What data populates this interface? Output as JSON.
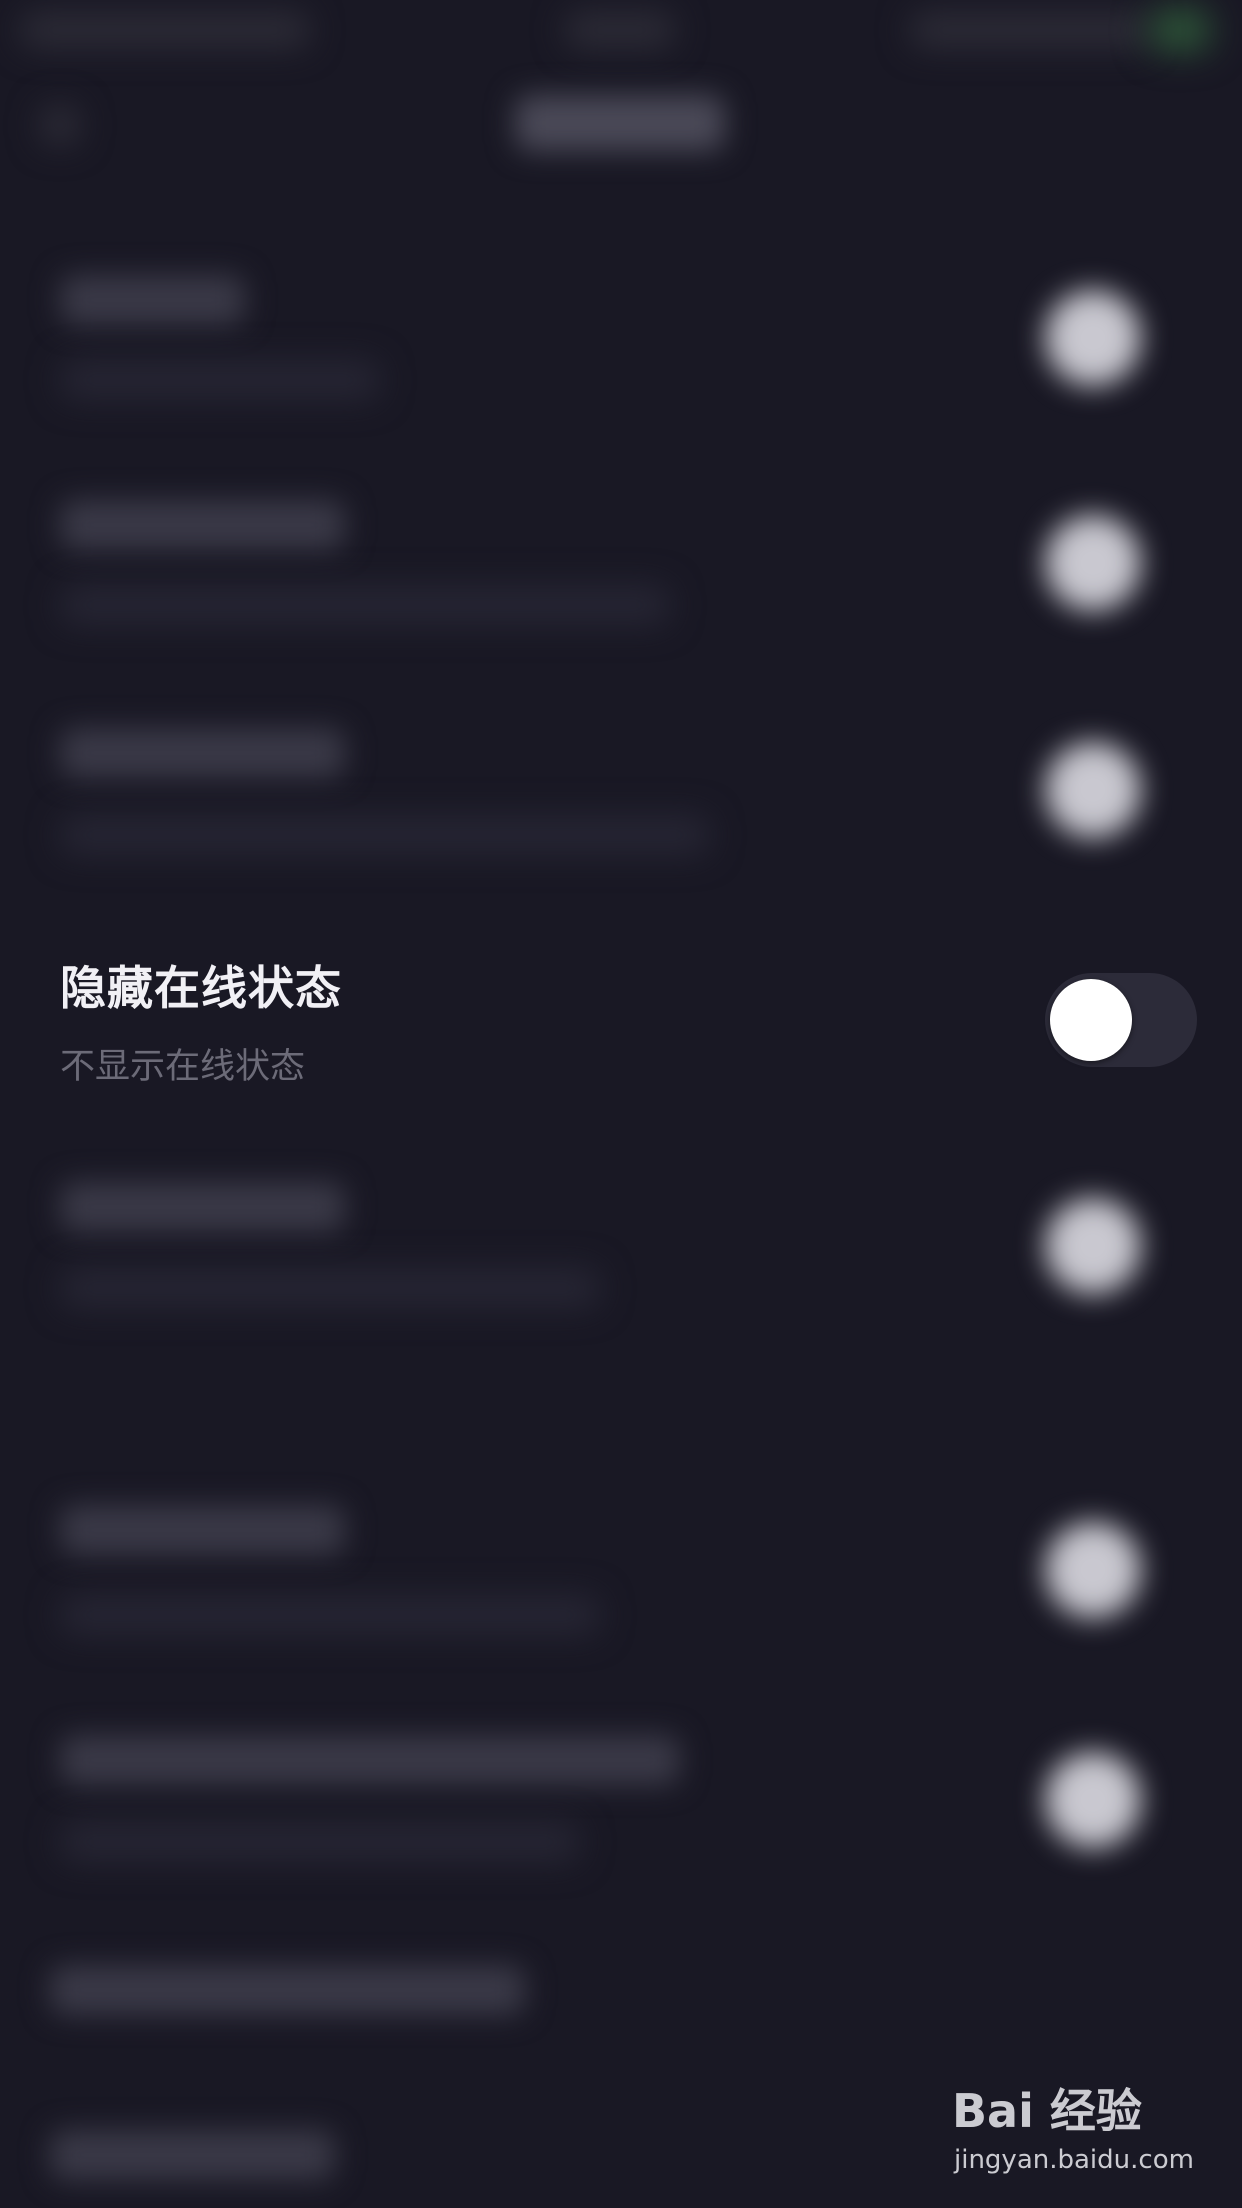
{
  "setting": {
    "title": "隐藏在线状态",
    "subtitle": "不显示在线状态",
    "toggle_on": false
  },
  "watermark": {
    "brand": "Bai 经验",
    "url": "jingyan.baidu.com"
  },
  "colors": {
    "background": "#191824",
    "title": "#f1f0f5",
    "subtitle": "#6c6b78",
    "toggle_track": "#2c2b39",
    "toggle_thumb": "#ffffff"
  }
}
